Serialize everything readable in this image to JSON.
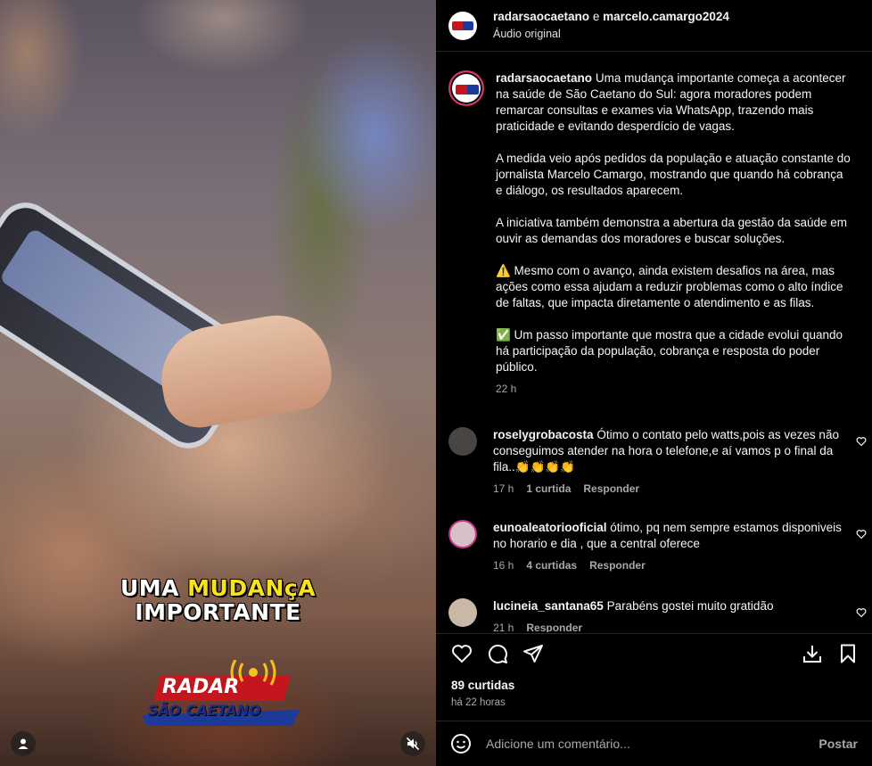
{
  "video": {
    "overlay_line1_pre": "UMA ",
    "overlay_line1_hl": "MUDANçA",
    "overlay_line2": "IMPORTANTE",
    "logo_main": "RADAR",
    "logo_sub": "SÃO CAETANO"
  },
  "header": {
    "user1": "radarsaocaetano",
    "conj": " e ",
    "user2": "marcelo.camargo2024",
    "audio": "Áudio original"
  },
  "caption": {
    "username": "radarsaocaetano",
    "paragraphs": [
      "Uma mudança importante começa a acontecer na saúde de São Caetano do Sul: agora moradores podem remarcar consultas e exames via WhatsApp, trazendo mais praticidade e evitando desperdício de vagas.",
      "A medida veio após pedidos da população e atuação constante do jornalista Marcelo Camargo, mostrando que quando há cobrança e diálogo, os resultados aparecem.",
      "A iniciativa também demonstra a abertura da gestão da saúde em ouvir as demandas dos moradores e buscar soluções.",
      "⚠️ Mesmo com o avanço, ainda existem desafios na área, mas ações como essa ajudam a reduzir problemas como o alto índice de faltas, que impacta diretamente o atendimento e as filas.",
      "✅ Um passo importante que mostra que a cidade evolui quando há participação da população, cobrança e resposta do poder público."
    ],
    "time": "22 h"
  },
  "comments": [
    {
      "username": "roselygrobacosta",
      "text": "Ótimo o contato pelo watts,pois as vezes não conseguimos atender na hora o telefone,e aí vamos p o final da fila..👏👏👏👏",
      "time": "17 h",
      "likes": "1 curtida",
      "reply": "Responder"
    },
    {
      "username": "eunoaleatoriooficial",
      "text": "ótimo, pq nem sempre estamos disponiveis no horario e dia , que a central oferece",
      "time": "16 h",
      "likes": "4 curtidas",
      "reply": "Responder"
    },
    {
      "username": "lucineia_santana65",
      "text": "Parabéns gostei muito gratidão",
      "time": "21 h",
      "reply": "Responder"
    }
  ],
  "footer": {
    "likes": "89 curtidas",
    "time": "há 22 horas",
    "comment_placeholder": "Adicione um comentário...",
    "post_label": "Postar"
  },
  "icons": {
    "like": "heart-icon",
    "comment": "comment-icon",
    "share": "send-icon",
    "download": "download-icon",
    "save": "bookmark-icon",
    "emoji": "emoji-icon",
    "mute": "muted-speaker-icon",
    "user": "user-icon"
  }
}
